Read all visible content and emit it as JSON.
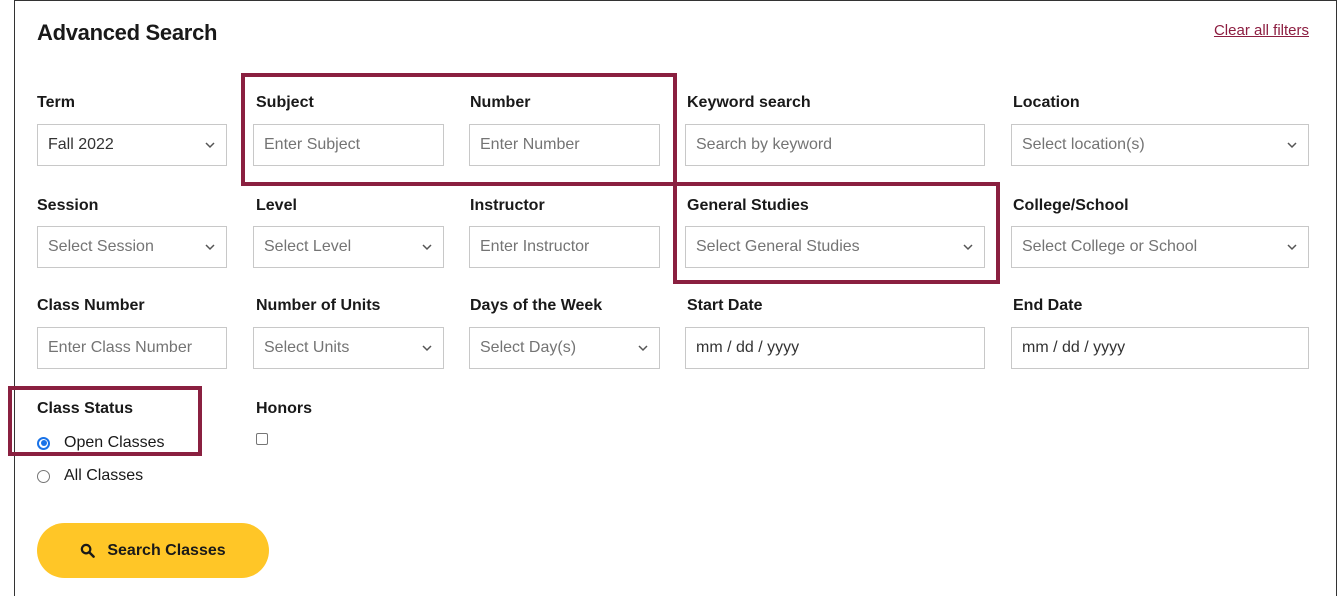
{
  "header": {
    "title": "Advanced Search",
    "clear_label": "Clear all filters"
  },
  "row1": {
    "term": {
      "label": "Term",
      "value": "Fall 2022"
    },
    "subject": {
      "label": "Subject",
      "placeholder": "Enter Subject"
    },
    "number": {
      "label": "Number",
      "placeholder": "Enter Number"
    },
    "keyword": {
      "label": "Keyword search",
      "placeholder": "Search by keyword"
    },
    "location": {
      "label": "Location",
      "value": "Select location(s)"
    }
  },
  "row2": {
    "session": {
      "label": "Session",
      "value": "Select Session"
    },
    "level": {
      "label": "Level",
      "value": "Select Level"
    },
    "instructor": {
      "label": "Instructor",
      "placeholder": "Enter Instructor"
    },
    "general_studies": {
      "label": "General Studies",
      "value": "Select General Studies"
    },
    "college": {
      "label": "College/School",
      "value": "Select College or School"
    }
  },
  "row3": {
    "class_number": {
      "label": "Class Number",
      "placeholder": "Enter Class Number"
    },
    "units": {
      "label": "Number of Units",
      "value": "Select Units"
    },
    "days": {
      "label": "Days of the Week",
      "value": "Select Day(s)"
    },
    "start_date": {
      "label": "Start Date",
      "value": "mm / dd / yyyy"
    },
    "end_date": {
      "label": "End Date",
      "value": "mm / dd / yyyy"
    }
  },
  "class_status": {
    "label": "Class Status",
    "options": [
      "Open Classes",
      "All Classes"
    ],
    "selected": "Open Classes"
  },
  "honors": {
    "label": "Honors",
    "checked": false
  },
  "search_button": {
    "label": "Search Classes",
    "icon": "search-icon"
  },
  "colors": {
    "accent_maroon": "#8c1d40",
    "button_gold": "#ffc627",
    "radio_blue": "#1a73e8"
  }
}
